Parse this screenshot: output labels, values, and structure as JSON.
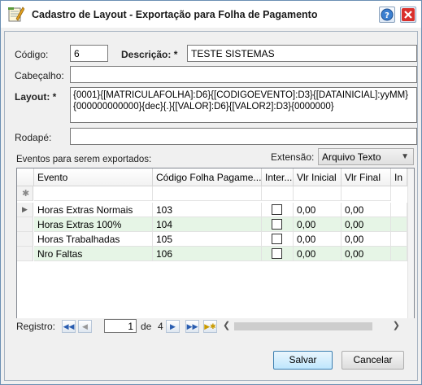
{
  "window": {
    "title": "Cadastro de Layout - Exportação para Folha de Pagamento"
  },
  "form": {
    "codigo_label": "Código:",
    "codigo_value": "6",
    "descricao_label": "Descrição: *",
    "descricao_value": "TESTE SISTEMAS",
    "cabecalho_label": "Cabeçalho:",
    "cabecalho_value": "",
    "layout_label": "Layout: *",
    "layout_value": "{0001}{[MATRICULAFOLHA]:D6}{[CODIGOEVENTO]:D3}{[DATAINICIAL]:yyMM}{000000000000}{dec}{.}{[VALOR]:D6}{[VALOR2]:D3}{0000000}",
    "rodape_label": "Rodapé:",
    "rodape_value": "",
    "eventos_label": "Eventos para serem exportados:",
    "extensao_label": "Extensão:",
    "extensao_value": "Arquivo Texto"
  },
  "grid": {
    "columns": [
      "Evento",
      "Código Folha Pagame...",
      "Inter...",
      "Vlr Inicial",
      "Vlr Final",
      "In"
    ],
    "rows": [
      {
        "evento": "Horas Extras Normais",
        "codigo": "103",
        "inicial": "0,00",
        "final": "0,00"
      },
      {
        "evento": "Horas Extras 100%",
        "codigo": "104",
        "inicial": "0,00",
        "final": "0,00"
      },
      {
        "evento": "Horas Trabalhadas",
        "codigo": "105",
        "inicial": "0,00",
        "final": "0,00"
      },
      {
        "evento": "Nro Faltas",
        "codigo": "106",
        "inicial": "0,00",
        "final": "0,00"
      }
    ]
  },
  "navigator": {
    "label": "Registro:",
    "current": "1",
    "of_label": "de",
    "total": "4"
  },
  "buttons": {
    "save": "Salvar",
    "cancel": "Cancelar"
  },
  "colors": {
    "alt_row": "#e6f5e6",
    "accent": "#2a5db0",
    "close": "#d9302c"
  }
}
